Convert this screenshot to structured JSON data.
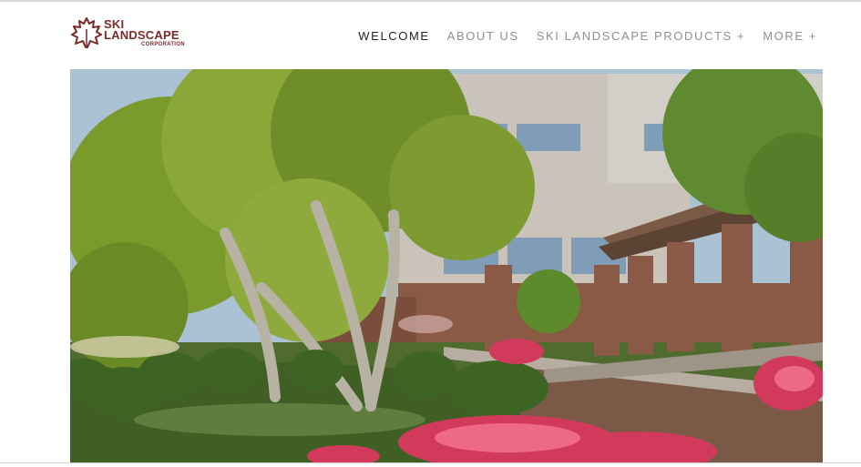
{
  "logo": {
    "line1": "SKI",
    "line2": "LANDSCAPE",
    "line3": "CORPORATION",
    "color": "#7b2a2a",
    "icon": "maple-leaf-icon"
  },
  "nav": {
    "items": [
      {
        "label": "WELCOME",
        "active": true
      },
      {
        "label": "ABOUT US",
        "active": false
      },
      {
        "label": "SKI LANDSCAPE PRODUCTS +",
        "active": false
      },
      {
        "label": "MORE +",
        "active": false
      }
    ]
  }
}
